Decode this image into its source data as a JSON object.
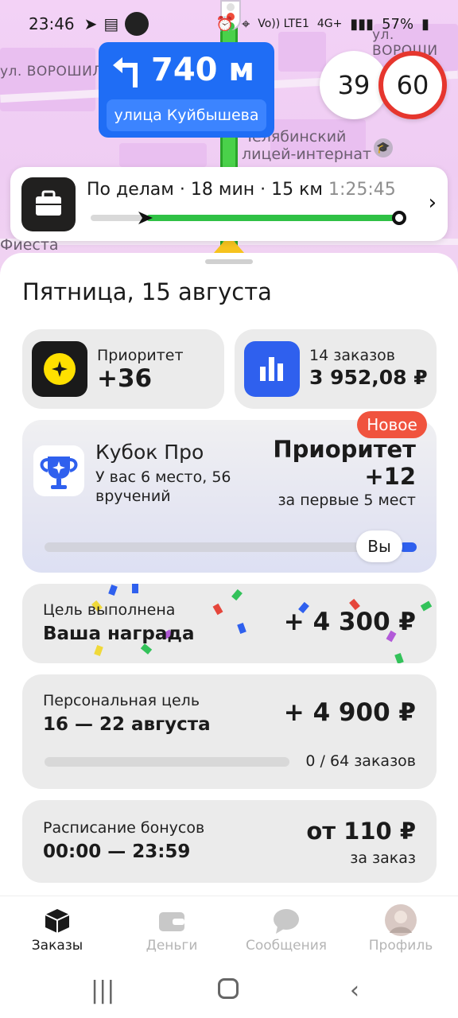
{
  "status_bar": {
    "time": "23:46",
    "network": "Vo)) LTE1",
    "signal": "4G+",
    "battery": "57%"
  },
  "map": {
    "street_top_right": "ул. ВОРОШИ",
    "street_left": "ул. ВОРОШИЛО",
    "poi_line1": "Челябинский",
    "poi_line2": "лицей-интернат",
    "poi_left": "Фиеста"
  },
  "navigation": {
    "distance": "740 м",
    "street": "улица Куйбышева",
    "turn_icon": "turn-left-icon"
  },
  "speed": {
    "current": "39",
    "limit": "60"
  },
  "route": {
    "title": "По делам · 18 мин · 15 км",
    "eta": "1:25:45",
    "progress": 0.18
  },
  "sheet": {
    "title": "Пятница, 15 августа",
    "priority": {
      "label": "Приоритет",
      "value": "+36"
    },
    "orders": {
      "label": "14 заказов",
      "value": "3 952,08 ₽"
    },
    "cup": {
      "badge": "Новое",
      "title": "Кубок Про",
      "subtitle": "У вас 6 место, 56 вручений",
      "reward_title": "Приоритет",
      "reward_value": "+12",
      "reward_note": "за первые 5 мест",
      "you_label": "Вы",
      "position_fraction": 0.95
    },
    "goal_done": {
      "label": "Цель выполнена",
      "subtitle": "Ваша награда",
      "amount": "+ 4 300 ₽"
    },
    "personal_goal": {
      "label": "Персональная цель",
      "dates": "16 — 22 августа",
      "amount": "+ 4 900 ₽",
      "progress_text": "0 / 64 заказов",
      "progress": 0
    },
    "bonus_schedule": {
      "label": "Расписание бонусов",
      "hours": "00:00 — 23:59",
      "amount": "от 110 ₽",
      "note": "за заказ"
    }
  },
  "tabs": [
    {
      "label": "Заказы",
      "icon": "box-icon",
      "active": true
    },
    {
      "label": "Деньги",
      "icon": "wallet-icon",
      "active": false
    },
    {
      "label": "Сообщения",
      "icon": "chat-icon",
      "active": false
    },
    {
      "label": "Профиль",
      "icon": "avatar-icon",
      "active": false
    }
  ],
  "colors": {
    "accent_blue": "#1f6df5",
    "route_green": "#2fc145",
    "badge_red": "#f0533e",
    "priority_yellow": "#ffe000"
  }
}
